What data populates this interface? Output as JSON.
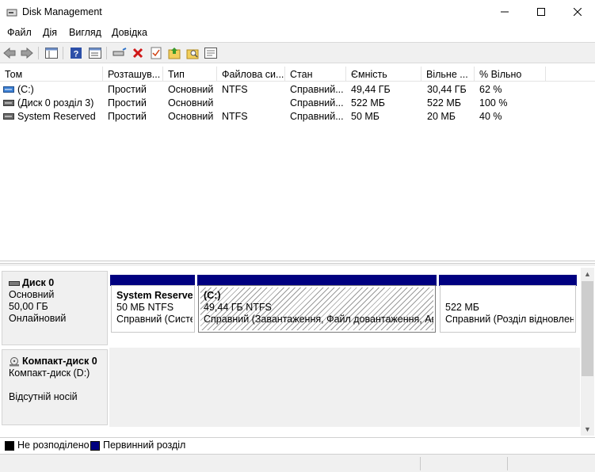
{
  "window": {
    "title": "Disk Management"
  },
  "menu": [
    "Файл",
    "Дія",
    "Вигляд",
    "Довідка"
  ],
  "volumes": {
    "columns": [
      "Том",
      "Розташув...",
      "Тип",
      "Файлова си...",
      "Стан",
      "Ємність",
      "Вільне ...",
      "% Вільно"
    ],
    "rows": [
      {
        "name": "(C:)",
        "layout": "Простий",
        "type": "Основний",
        "fs": "NTFS",
        "status": "Справний...",
        "capacity": "49,44 ГБ",
        "free": "30,44 ГБ",
        "pct": "62 %"
      },
      {
        "name": "(Диск 0 розділ 3)",
        "layout": "Простий",
        "type": "Основний",
        "fs": "",
        "status": "Справний...",
        "capacity": "522 МБ",
        "free": "522 МБ",
        "pct": "100 %"
      },
      {
        "name": "System Reserved",
        "layout": "Простий",
        "type": "Основний",
        "fs": "NTFS",
        "status": "Справний...",
        "capacity": "50 МБ",
        "free": "20 МБ",
        "pct": "40 %"
      }
    ]
  },
  "disk0": {
    "name": "Диск 0",
    "type": "Основний",
    "size": "50,00 ГБ",
    "state": "Онлайновий",
    "partitions": [
      {
        "name": "System Reserved",
        "size": "50 МБ NTFS",
        "status": "Справний (Систе"
      },
      {
        "name": "(C:)",
        "size": "49,44 ГБ NTFS",
        "status": "Справний (Завантаження, Файл довантаження, Авар"
      },
      {
        "name": "",
        "size": "522 МБ",
        "status": "Справний (Розділ відновленн"
      }
    ]
  },
  "cdrom0": {
    "name": "Компакт-диск 0",
    "type": "Компакт-диск (D:)",
    "state": "Відсутній носій"
  },
  "legend": {
    "unallocated": "Не розподілено",
    "primary": "Первинний розділ"
  },
  "colors": {
    "primary_partition": "#000080",
    "unallocated": "#000000"
  }
}
